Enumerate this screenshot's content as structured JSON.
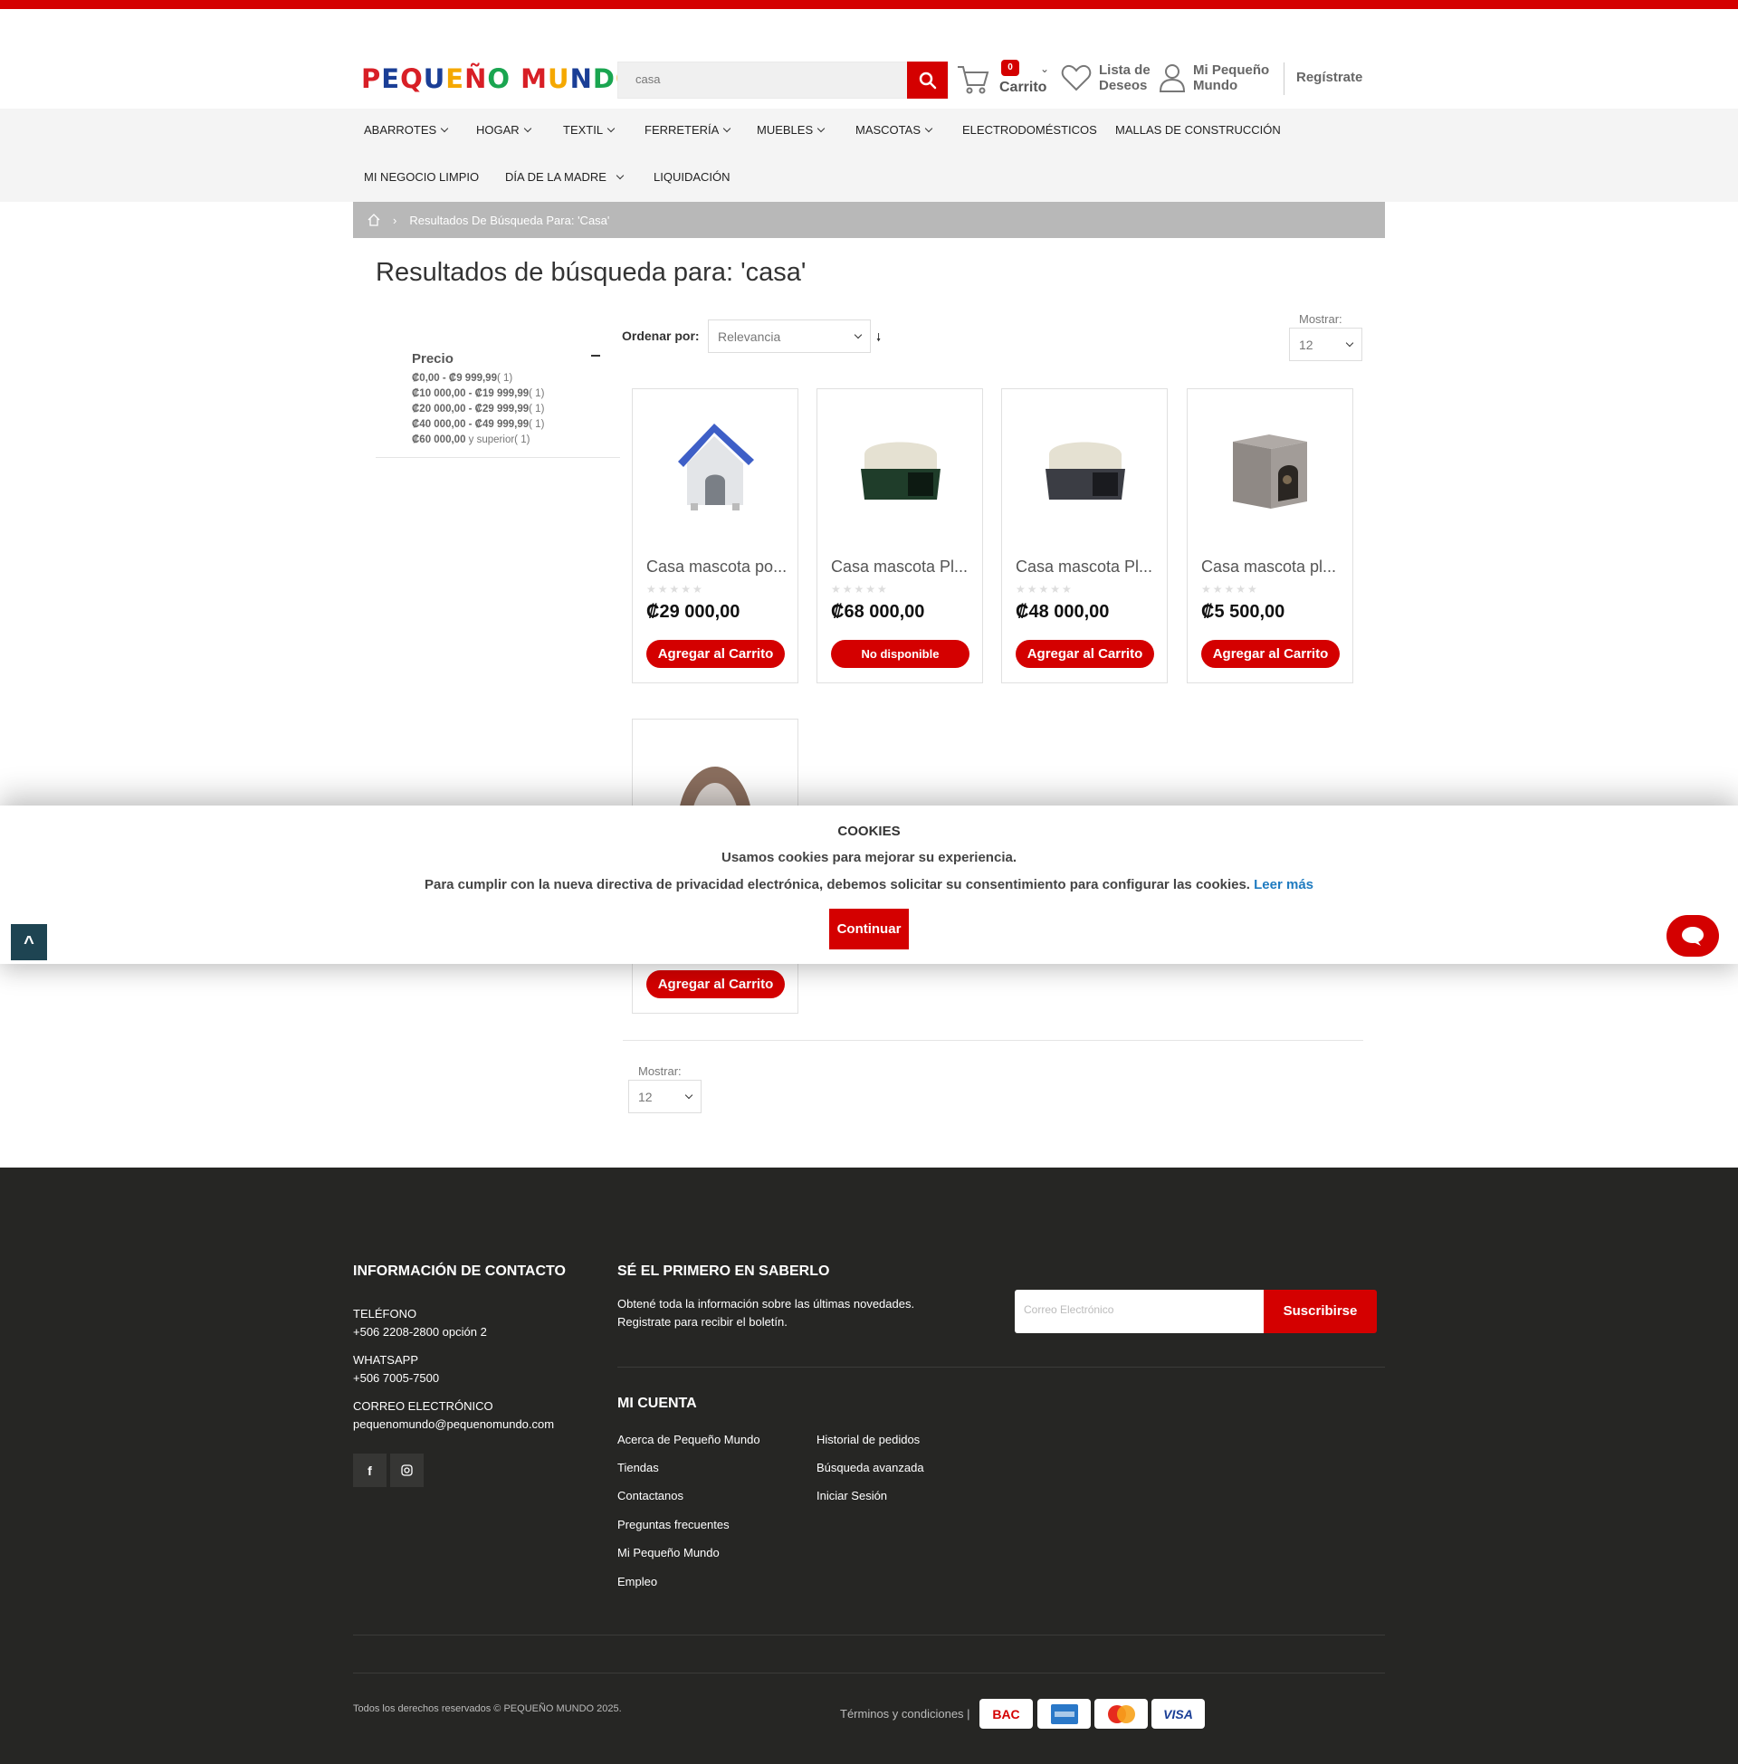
{
  "header": {
    "logo_letters": [
      {
        "ch": "P",
        "color": "#d81f26"
      },
      {
        "ch": "E",
        "color": "#1a3e96"
      },
      {
        "ch": "Q",
        "color": "#d81f26"
      },
      {
        "ch": "U",
        "color": "#1a3e96"
      },
      {
        "ch": "E",
        "color": "#f5a800"
      },
      {
        "ch": "Ñ",
        "color": "#d81f26"
      },
      {
        "ch": "O",
        "color": "#1aa550"
      },
      {
        "ch": " ",
        "color": "#000"
      },
      {
        "ch": "M",
        "color": "#d81f26"
      },
      {
        "ch": "U",
        "color": "#f5a800"
      },
      {
        "ch": "N",
        "color": "#1a3e96"
      },
      {
        "ch": "D",
        "color": "#1aa550"
      },
      {
        "ch": "O",
        "color": "#f5a800"
      }
    ],
    "search_value": "casa",
    "cart_count": "0",
    "cart_label": "Carrito",
    "wishlist_label_1": "Lista de",
    "wishlist_label_2": "Deseos",
    "account_label_1": "Mi Pequeño",
    "account_label_2": "Mundo",
    "register_label": "Regístrate"
  },
  "nav": {
    "items": [
      "ABARROTES",
      "HOGAR",
      "TEXTIL",
      "FERRETERÍA",
      "MUEBLES",
      "MASCOTAS",
      "ELECTRODOMÉSTICOS",
      "MALLAS DE CONSTRUCCIÓN",
      "MI NEGOCIO LIMPIO",
      "DÍA DE LA MADRE",
      "LIQUIDACIÓN"
    ]
  },
  "breadcrumb": {
    "current": "Resultados De Búsqueda Para: 'Casa'"
  },
  "page_title": "Resultados de búsqueda para: 'casa'",
  "filters": {
    "title": "Precio",
    "ranges": [
      {
        "range": "₡0,00 - ₡9 999,99",
        "count": "( 1)"
      },
      {
        "range": "₡10 000,00 - ₡19 999,99",
        "count": "( 1)"
      },
      {
        "range": "₡20 000,00 - ₡29 999,99",
        "count": "( 1)"
      },
      {
        "range": "₡40 000,00 - ₡49 999,99",
        "count": "( 1)"
      },
      {
        "range": "₡60 000,00",
        "count": "y superior( 1)"
      }
    ]
  },
  "toolbar": {
    "sort_label": "Ordenar por:",
    "sort_value": "Relevancia",
    "show_label": "Mostrar:",
    "show_value": "12"
  },
  "products": [
    {
      "name": "Casa mascota po...",
      "price": "₡29 000,00",
      "button": "Agregar al Carrito",
      "available": true,
      "rating": 0
    },
    {
      "name": "Casa mascota Pl...",
      "price": "₡68 000,00",
      "button": "No disponible",
      "available": false,
      "rating": 0
    },
    {
      "name": "Casa mascota Pl...",
      "price": "₡48 000,00",
      "button": "Agregar al Carrito",
      "available": true,
      "rating": 0
    },
    {
      "name": "Casa mascota pl...",
      "price": "₡5 500,00",
      "button": "Agregar al Carrito",
      "available": true,
      "rating": 0
    },
    {
      "name": "",
      "price": "",
      "button": "Agregar al Carrito",
      "available": true,
      "rating": 0
    }
  ],
  "cookie": {
    "title": "COOKIES",
    "line1": "Usamos cookies para mejorar su experiencia.",
    "line2": "Para cumplir con la nueva directiva de privacidad electrónica, debemos solicitar su consentimiento para configurar las cookies.",
    "read_more": "Leer más",
    "button": "Continuar"
  },
  "back_to_top": "^",
  "footer": {
    "contact_title": "INFORMACIÓN DE CONTACTO",
    "phone_label": "TELÉFONO",
    "phone": "+506 2208-2800 opción 2",
    "whatsapp_label": "WHATSAPP",
    "whatsapp": "+506 7005-7500",
    "email_label": "CORREO ELECTRÓNICO",
    "email": "pequenomundo@pequenomundo.com",
    "newsletter_title": "SÉ EL PRIMERO EN SABERLO",
    "newsletter_line1": "Obtené toda la información sobre las últimas novedades.",
    "newsletter_line2": "Registrate para recibir el boletín.",
    "email_placeholder": "Correo Electrónico",
    "subscribe": "Suscribirse",
    "account_title": "MI CUENTA",
    "links_col1": [
      "Acerca de Pequeño Mundo",
      "Tiendas",
      "Contactanos",
      "Preguntas frecuentes",
      "Mi Pequeño Mundo",
      "Empleo"
    ],
    "links_col2": [
      "Historial de pedidos",
      "Búsqueda avanzada",
      "Iniciar Sesión"
    ],
    "copyright": "Todos los derechos reservados © PEQUEÑO MUNDO 2025.",
    "terms": "Términos y condiciones |",
    "payments": [
      "BAC",
      "AMEX",
      "Mastercard",
      "VISA"
    ]
  },
  "colors": {
    "brand_red": "#d40000",
    "footer_bg": "#262624",
    "breadcrumb_bg": "#b8b8b8"
  }
}
